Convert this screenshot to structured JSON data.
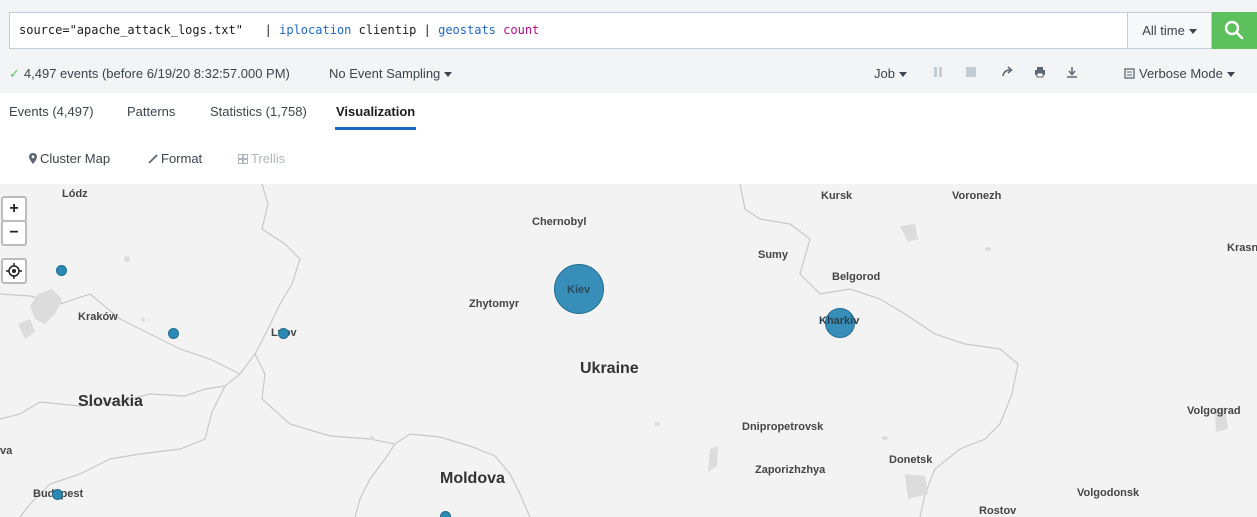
{
  "search": {
    "query_source": "source=\"apache_attack_logs.txt\"",
    "pipe1": "|",
    "cmd_iplocation": "iplocation",
    "arg_clientip": "clientip",
    "pipe2": "|",
    "cmd_geostats": "geostats",
    "arg_count": "count",
    "time_range": "All time"
  },
  "status": {
    "events_summary": "4,497 events (before 6/19/20 8:32:57.000 PM)",
    "sampling": "No Event Sampling",
    "job": "Job",
    "mode": "Verbose Mode"
  },
  "tabs": [
    {
      "label": "Events (4,497)"
    },
    {
      "label": "Patterns"
    },
    {
      "label": "Statistics (1,758)"
    },
    {
      "label": "Visualization"
    }
  ],
  "viz_toolbar": {
    "cluster_map": "Cluster Map",
    "format": "Format",
    "trellis": "Trellis"
  },
  "map": {
    "countries": [
      "Ukraine",
      "Slovakia",
      "Moldova"
    ],
    "cities": [
      "Lódz",
      "Kraków",
      "Lvov",
      "Chernobyl",
      "Zhytomyr",
      "Kiev",
      "Kursk",
      "Voronezh",
      "Sumy",
      "Belgorod",
      "Kharkiv",
      "Krasn",
      "Dnipropetrovsk",
      "Zaporizhzhya",
      "Donetsk",
      "Volgograd",
      "Volgodonsk",
      "Rostov",
      "Budapest",
      "va"
    ],
    "zoom_in": "+",
    "zoom_out": "−",
    "marker_color": "#2c89b5"
  }
}
